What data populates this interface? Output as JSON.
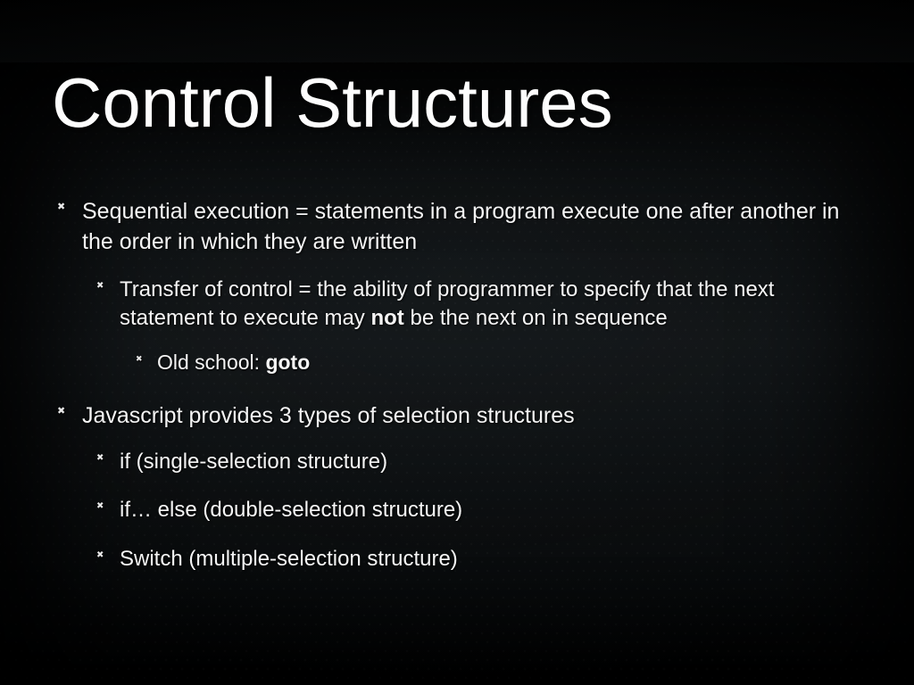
{
  "title": "Control Structures",
  "bullets": {
    "seq": "Sequential execution = statements in a program execute one after another in the order in which they are written",
    "transfer_pre": "Transfer of control = the ability of programmer to specify that the next statement to execute may ",
    "transfer_bold": "not",
    "transfer_post": " be the next on in sequence",
    "goto_pre": "Old school: ",
    "goto_bold": "goto",
    "jsTypes": "Javascript provides 3 types of selection structures",
    "if": "if (single-selection structure)",
    "ifelse": "if… else (double-selection structure)",
    "switch": "Switch (multiple-selection structure)"
  }
}
